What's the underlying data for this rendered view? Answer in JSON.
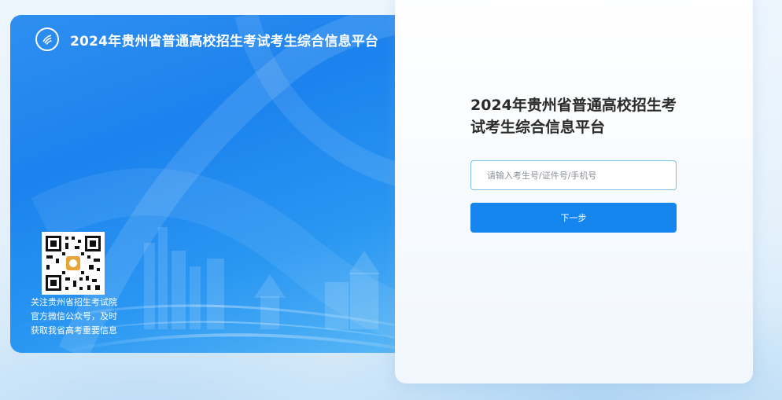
{
  "banner": {
    "logo_icon": "exam-institute-logo-icon",
    "title": "2024年贵州省普通高校招生考试考生综合信息平台",
    "qr_icon": "wechat-qr-code-icon",
    "qr_note_lines": [
      "关注贵州省招生考试院",
      "官方微信公众号，及时",
      "获取我省高考重要信息"
    ]
  },
  "login": {
    "title": "2024年贵州省普通高校招生考试考生综合信息平台",
    "id_input": {
      "placeholder": "请输入考生号/证件号/手机号",
      "value": ""
    },
    "next_label": "下一步"
  },
  "colors": {
    "banner_blue": "#1b82ee",
    "button_blue": "#1586ee",
    "input_border": "#7fc0e8",
    "title_text": "#2b2b2b"
  }
}
